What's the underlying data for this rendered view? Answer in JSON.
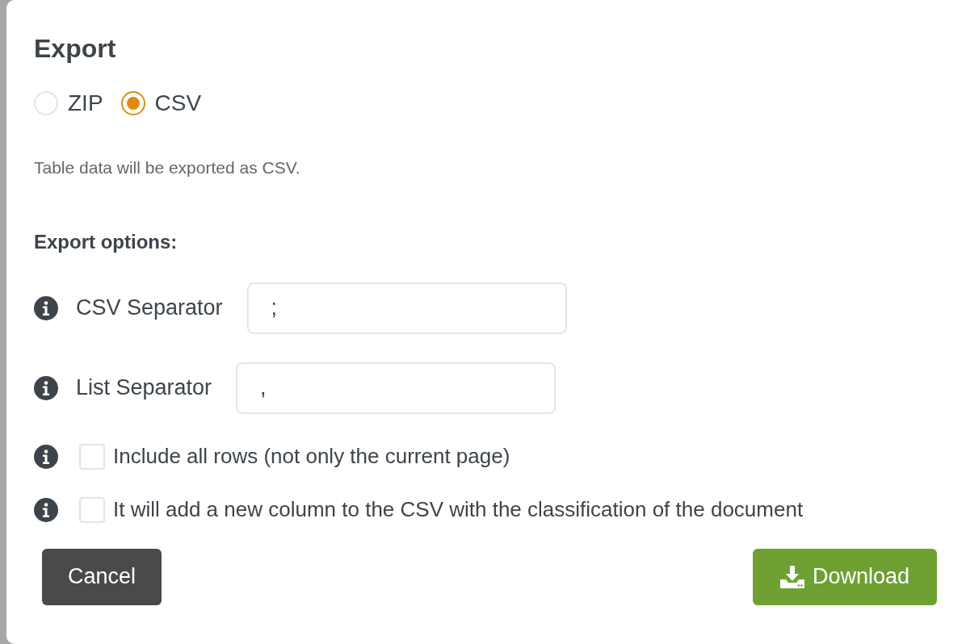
{
  "dialog": {
    "title": "Export",
    "formats": [
      {
        "label": "ZIP",
        "selected": false
      },
      {
        "label": "CSV",
        "selected": true
      }
    ],
    "description": "Table data will be exported as CSV.",
    "options_heading": "Export options:",
    "options": [
      {
        "kind": "field",
        "label": "CSV Separator",
        "value": ";"
      },
      {
        "kind": "field",
        "label": "List Separator",
        "value": ","
      },
      {
        "kind": "checkbox",
        "label": "Include all rows (not only the current page)",
        "checked": false
      },
      {
        "kind": "checkbox",
        "label": "It will add a new column to the CSV with the classification of the document",
        "checked": false
      }
    ],
    "buttons": {
      "cancel": "Cancel",
      "download": "Download"
    }
  }
}
